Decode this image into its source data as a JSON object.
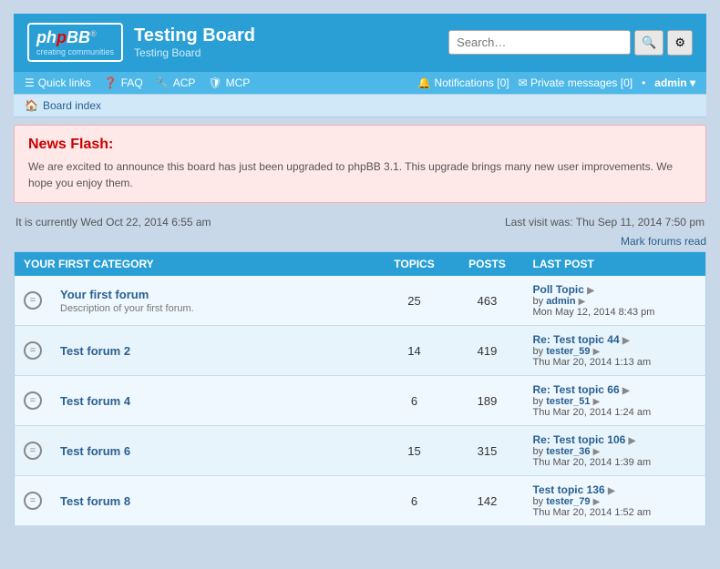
{
  "header": {
    "logo_main": "phpBB",
    "logo_sub": "creating communities",
    "logo_reg": "®",
    "board_title": "Testing Board",
    "board_subtitle": "Testing Board",
    "search_placeholder": "Search…"
  },
  "navbar": {
    "quick_links": "Quick links",
    "faq": "FAQ",
    "acp": "ACP",
    "mcp": "MCP",
    "notifications_label": "Notifications",
    "notifications_count": "0",
    "private_messages_label": "Private messages",
    "private_messages_count": "0",
    "user": "admin",
    "separator": "•"
  },
  "breadcrumb": {
    "board_index": "Board index"
  },
  "news_flash": {
    "title": "News Flash:",
    "body": "We are excited to announce this board has just been upgraded to phpBB 3.1. This upgrade brings many new user improvements. We hope you enjoy them."
  },
  "status": {
    "current_time": "It is currently Wed Oct 22, 2014 6:55 am",
    "last_visit": "Last visit was: Thu Sep 11, 2014 7:50 pm",
    "mark_read": "Mark forums read"
  },
  "table": {
    "category": "YOUR FIRST CATEGORY",
    "cols": {
      "forum": "",
      "topics": "TOPICS",
      "posts": "POSTS",
      "lastpost": "LAST POST"
    },
    "forums": [
      {
        "name": "Your first forum",
        "desc": "Description of your first forum.",
        "topics": "25",
        "posts": "463",
        "lastpost_title": "Poll Topic",
        "lastpost_by": "admin",
        "lastpost_date": "Mon May 12, 2014 8:43 pm"
      },
      {
        "name": "Test forum 2",
        "desc": "",
        "topics": "14",
        "posts": "419",
        "lastpost_title": "Re: Test topic 44",
        "lastpost_by": "tester_59",
        "lastpost_date": "Thu Mar 20, 2014 1:13 am"
      },
      {
        "name": "Test forum 4",
        "desc": "",
        "topics": "6",
        "posts": "189",
        "lastpost_title": "Re: Test topic 66",
        "lastpost_by": "tester_51",
        "lastpost_date": "Thu Mar 20, 2014 1:24 am"
      },
      {
        "name": "Test forum 6",
        "desc": "",
        "topics": "15",
        "posts": "315",
        "lastpost_title": "Re: Test topic 106",
        "lastpost_by": "tester_36",
        "lastpost_date": "Thu Mar 20, 2014 1:39 am"
      },
      {
        "name": "Test forum 8",
        "desc": "",
        "topics": "6",
        "posts": "142",
        "lastpost_title": "Test topic 136",
        "lastpost_by": "tester_79",
        "lastpost_date": "Thu Mar 20, 2014 1:52 am"
      }
    ]
  }
}
